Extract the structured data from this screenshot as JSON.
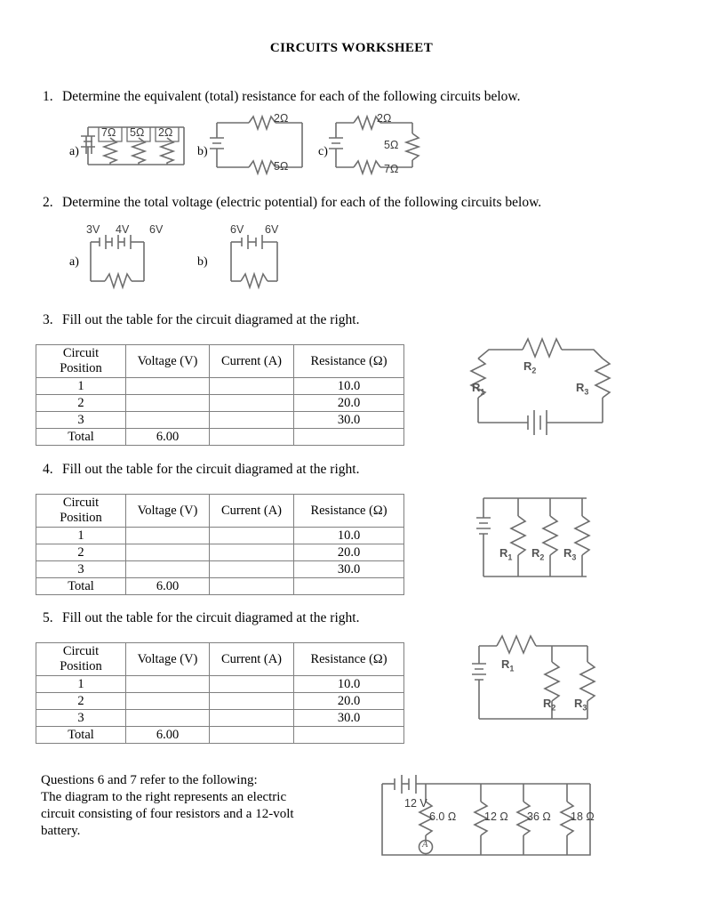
{
  "document": {
    "title": "CIRCUITS WORKSHEET"
  },
  "questions": [
    {
      "number": "1.",
      "text": "Determine the equivalent (total) resistance for each of the following circuits below.",
      "parts": [
        {
          "label": "a)",
          "type": "parallel-three-resistors",
          "resistors": [
            "7Ω",
            "5Ω",
            "2Ω"
          ]
        },
        {
          "label": "b)",
          "type": "series-loop-two-resistors",
          "resistors": [
            "2Ω",
            "5Ω"
          ]
        },
        {
          "label": "c)",
          "type": "series-loop-three-resistors",
          "resistors": [
            "2Ω",
            "5Ω",
            "7Ω"
          ]
        }
      ]
    },
    {
      "number": "2.",
      "text": "Determine the total voltage (electric potential) for each of the following circuits below.",
      "parts": [
        {
          "label": "a)",
          "type": "three-cells-series",
          "cells": [
            "3V",
            "4V",
            "6V"
          ]
        },
        {
          "label": "b)",
          "type": "two-cells-series",
          "cells": [
            "6V",
            "6V"
          ]
        }
      ]
    },
    {
      "number": "3.",
      "text": "Fill out the table for the circuit diagramed at the right.",
      "diagram": {
        "type": "series",
        "resistor_labels": [
          "R",
          "R",
          "R"
        ],
        "resistor_subscripts": [
          "1",
          "2",
          "3"
        ]
      }
    },
    {
      "number": "4.",
      "text": "Fill out the table for the circuit diagramed at the right.",
      "diagram": {
        "type": "parallel",
        "resistor_labels": [
          "R",
          "R",
          "R"
        ],
        "resistor_subscripts": [
          "1",
          "2",
          "3"
        ]
      }
    },
    {
      "number": "5.",
      "text": "Fill out the table for the circuit diagramed at the right.",
      "diagram": {
        "type": "combination",
        "resistor_labels": [
          "R",
          "R",
          "R"
        ],
        "resistor_subscripts": [
          "1",
          "2",
          "3"
        ]
      }
    }
  ],
  "table": {
    "headers": [
      "Circuit Position",
      "Voltage (V)",
      "Current (A)",
      "Resistance (Ω)"
    ],
    "header_pos_line1": "Circuit",
    "header_pos_line2": "Position",
    "rows": [
      {
        "position": "1",
        "voltage": "",
        "current": "",
        "resistance": "10.0"
      },
      {
        "position": "2",
        "voltage": "",
        "current": "",
        "resistance": "20.0"
      },
      {
        "position": "3",
        "voltage": "",
        "current": "",
        "resistance": "30.0"
      },
      {
        "position": "Total",
        "voltage": "6.00",
        "current": "",
        "resistance": ""
      }
    ]
  },
  "final_section": {
    "line1": "Questions 6 and 7 refer to the following:",
    "line2": "The diagram to the right represents an electric",
    "line3": "circuit consisting of four resistors and a 12-volt",
    "line4": "battery.",
    "diagram": {
      "battery": "12 V",
      "resistors": [
        "6.0 Ω",
        "12 Ω",
        "36 Ω",
        "18 Ω"
      ],
      "meter": "A"
    }
  },
  "colors": {
    "text": "#000000",
    "wire": "#6e6e6e",
    "table_border": "#808080",
    "background": "#ffffff"
  }
}
